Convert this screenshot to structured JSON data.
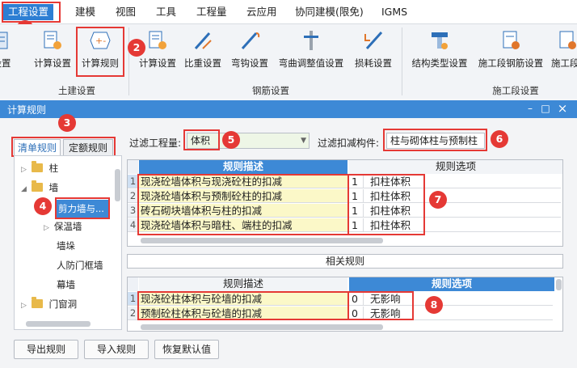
{
  "menubar": {
    "items": [
      "工程设置",
      "建模",
      "视图",
      "工具",
      "工程量",
      "云应用",
      "协同建模(限免)",
      "IGMS"
    ]
  },
  "ribbon": {
    "buttons": [
      "设置",
      "计算设置",
      "计算规则",
      "计算设置",
      "比重设置",
      "弯钩设置",
      "弯曲调整值设置",
      "损耗设置",
      "结构类型设置",
      "施工段钢筋设置",
      "施工段"
    ],
    "groups": [
      "土建设置",
      "钢筋设置",
      "施工段设置"
    ]
  },
  "badges": [
    "1",
    "2",
    "3",
    "4",
    "5",
    "6",
    "7",
    "8"
  ],
  "dialog": {
    "title": "计算规则",
    "controls": {
      "minimize": "–",
      "maximize": "□",
      "close": "×"
    },
    "tabs": [
      "清单规则",
      "定额规则"
    ],
    "tree": [
      {
        "label": "柱",
        "type": "folder",
        "expand": "▷"
      },
      {
        "label": "墙",
        "type": "folder",
        "expand": "◢"
      },
      {
        "label": "剪力墙与...",
        "type": "item",
        "expand": ""
      },
      {
        "label": "保温墙",
        "type": "item",
        "expand": "▷"
      },
      {
        "label": "墙垛",
        "type": "item",
        "expand": ""
      },
      {
        "label": "人防门框墙",
        "type": "item",
        "expand": ""
      },
      {
        "label": "幕墙",
        "type": "item",
        "expand": ""
      },
      {
        "label": "门窗洞",
        "type": "folder",
        "expand": "▷"
      }
    ],
    "filter_quantity_label": "过滤工程量:",
    "filter_quantity_value": "体积",
    "filter_member_label": "过滤扣减构件:",
    "filter_member_value": "柱与砌体柱与预制柱",
    "rules_table": {
      "headers": [
        "规则描述",
        "规则选项"
      ],
      "rows": [
        {
          "num": "1",
          "desc": "现浇砼墙体积与现浇砼柱的扣减",
          "opt_num": "1",
          "opt": "扣柱体积"
        },
        {
          "num": "2",
          "desc": "现浇砼墙体积与预制砼柱的扣减",
          "opt_num": "1",
          "opt": "扣柱体积"
        },
        {
          "num": "3",
          "desc": "砖石砌块墙体积与柱的扣减",
          "opt_num": "1",
          "opt": "扣柱体积"
        },
        {
          "num": "4",
          "desc": "现浇砼墙体积与暗柱、端柱的扣减",
          "opt_num": "1",
          "opt": "扣柱体积"
        }
      ]
    },
    "related_label": "相关规则",
    "related_table": {
      "headers": [
        "规则描述",
        "规则选项"
      ],
      "rows": [
        {
          "num": "1",
          "desc": "现浇砼柱体积与砼墙的扣减",
          "opt_num": "0",
          "opt": "无影响"
        },
        {
          "num": "2",
          "desc": "预制砼柱体积与砼墙的扣减",
          "opt_num": "0",
          "opt": "无影响"
        }
      ]
    },
    "buttons": [
      "导出规则",
      "导入规则",
      "恢复默认值"
    ]
  },
  "colors": {
    "accent": "#3d89d6",
    "highlight": "#e53935",
    "table_header": "#3d89d6",
    "cell_yellow": "#fbf8c8"
  },
  "icons": [
    "calc-settings-icon",
    "calc-rules-icon",
    "weight-settings-icon",
    "hook-settings-icon",
    "bend-adjust-icon",
    "loss-settings-icon",
    "structure-type-icon",
    "stage-rebar-icon",
    "folder-icon",
    "dropdown-arrow-icon"
  ]
}
